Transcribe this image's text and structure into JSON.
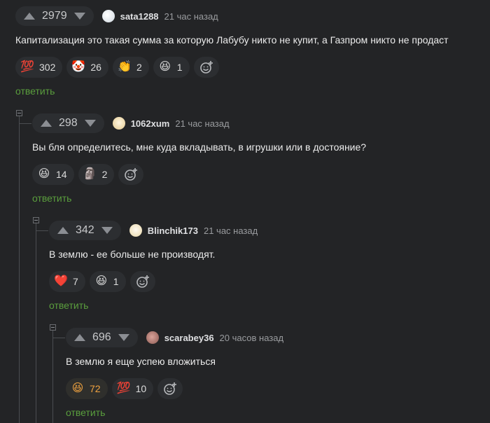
{
  "comments": [
    {
      "rating": "2979",
      "username": "sata1288",
      "time": "21 час назад",
      "text": "Капитализация это такая сумма за которую Лабубу никто не купит, а Газпром никто не продаст",
      "reactions": [
        {
          "emoji": "💯",
          "count": "302",
          "icon": "hundred-points-icon"
        },
        {
          "emoji": "🤡",
          "count": "26",
          "icon": "clown-face-icon"
        },
        {
          "emoji": "👏",
          "count": "2",
          "icon": "clapping-hands-icon"
        },
        {
          "emoji": "😆",
          "count": "1",
          "icon": "laughing-face-icon"
        }
      ],
      "reply": "ответить"
    },
    {
      "rating": "298",
      "username": "1062xum",
      "time": "21 час назад",
      "text": "Вы бля определитесь, мне куда вкладывать, в игрушки или в достояние?",
      "reactions": [
        {
          "emoji": "😆",
          "count": "14",
          "icon": "laughing-face-icon"
        },
        {
          "emoji": "🗿",
          "count": "2",
          "icon": "moai-icon"
        }
      ],
      "reply": "ответить"
    },
    {
      "rating": "342",
      "username": "Blinchik173",
      "time": "21 час назад",
      "text": "В землю - ее больше не производят.",
      "reactions": [
        {
          "emoji": "❤️",
          "count": "7",
          "icon": "heart-icon"
        },
        {
          "emoji": "😆",
          "count": "1",
          "icon": "laughing-face-icon"
        }
      ],
      "reply": "ответить"
    },
    {
      "rating": "696",
      "username": "scarabey36",
      "time": "20 часов назад",
      "text": "В землю я еще успею вложиться",
      "reactions": [
        {
          "emoji": "😆",
          "count": "72",
          "icon": "laughing-face-icon",
          "active": true
        },
        {
          "emoji": "💯",
          "count": "10",
          "icon": "hundred-points-icon"
        }
      ],
      "reply": "ответить"
    }
  ],
  "colors": {
    "background": "#232426",
    "reply_link": "#5a9e3d",
    "active_reaction": "#f0a340"
  }
}
